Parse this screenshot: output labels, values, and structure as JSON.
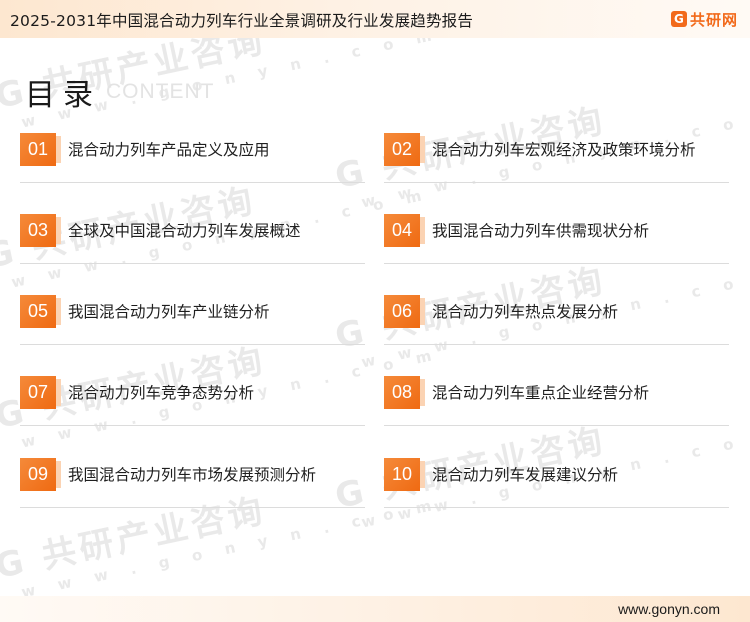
{
  "header": {
    "title": "2025-2031年中国混合动力列车行业全景调研及行业发展趋势报告",
    "logo_text": "共研网",
    "logo_mark": "G"
  },
  "toc": {
    "title": "目录",
    "subtitle": "CONTENT",
    "items": [
      {
        "num": "01",
        "label": "混合动力列车产品定义及应用"
      },
      {
        "num": "02",
        "label": "混合动力列车宏观经济及政策环境分析"
      },
      {
        "num": "03",
        "label": "全球及中国混合动力列车发展概述"
      },
      {
        "num": "04",
        "label": "我国混合动力列车供需现状分析"
      },
      {
        "num": "05",
        "label": "我国混合动力列车产业链分析"
      },
      {
        "num": "06",
        "label": "混合动力列车热点发展分析"
      },
      {
        "num": "07",
        "label": "混合动力列车竞争态势分析"
      },
      {
        "num": "08",
        "label": "混合动力列车重点企业经营分析"
      },
      {
        "num": "09",
        "label": "我国混合动力列车市场发展预测分析"
      },
      {
        "num": "10",
        "label": "混合动力列车发展建议分析"
      }
    ]
  },
  "watermark": {
    "brand": "G 共研产业咨询",
    "url": "w w w . g o n y n . c o m"
  },
  "footer": {
    "url": "www.gonyn.com"
  }
}
